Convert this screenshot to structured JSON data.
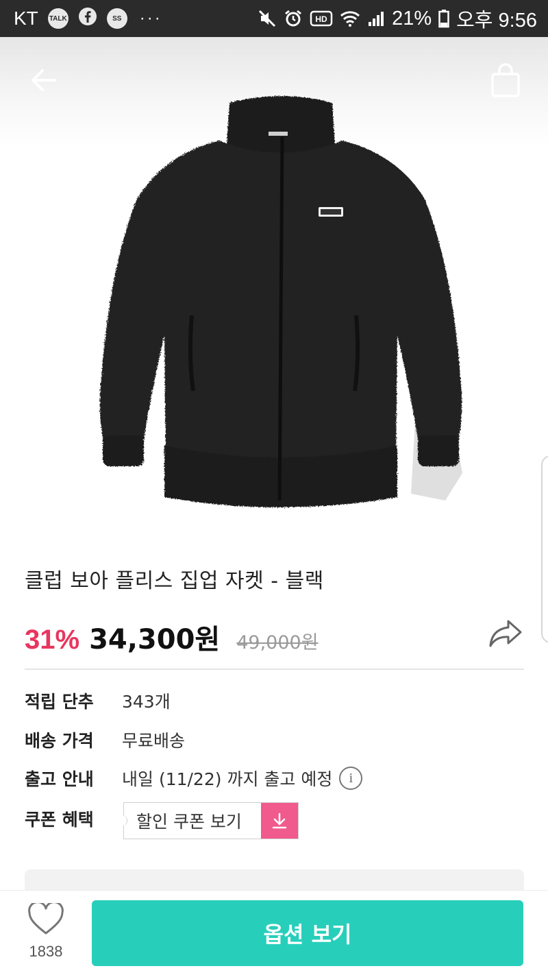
{
  "status_bar": {
    "carrier": "KT",
    "talk_badge": "TALK",
    "app_badge": "SS",
    "more": "···",
    "battery": "21%",
    "time": "오후 9:56"
  },
  "header": {
    "back_icon": "arrow-left-icon",
    "bag_icon": "shopping-bag-icon"
  },
  "product": {
    "image": "black-boa-fleece-jacket",
    "title": "클럽 보아 플리스 집업 자켓 - 블랙",
    "discount": "31%",
    "price": "34,300원",
    "original_price": "49,000원",
    "share_icon": "share-arrow-icon"
  },
  "info": [
    {
      "key": "적립 단추",
      "value": "343개"
    },
    {
      "key": "배송 가격",
      "value": "무료배송"
    },
    {
      "key": "출고 안내",
      "value": "내일 (11/22) 까지 출고 예정"
    },
    {
      "key": "쿠폰 혜택",
      "value": ""
    }
  ],
  "coupon": {
    "label": "할인 쿠폰 보기",
    "icon": "download-icon"
  },
  "bottom_bar": {
    "like_count": "1838",
    "like_icon": "heart-icon",
    "option_label": "옵션 보기"
  },
  "colors": {
    "discount": "#e8365f",
    "accent": "#27cfbb",
    "coupon_pink": "#f05a8d"
  }
}
